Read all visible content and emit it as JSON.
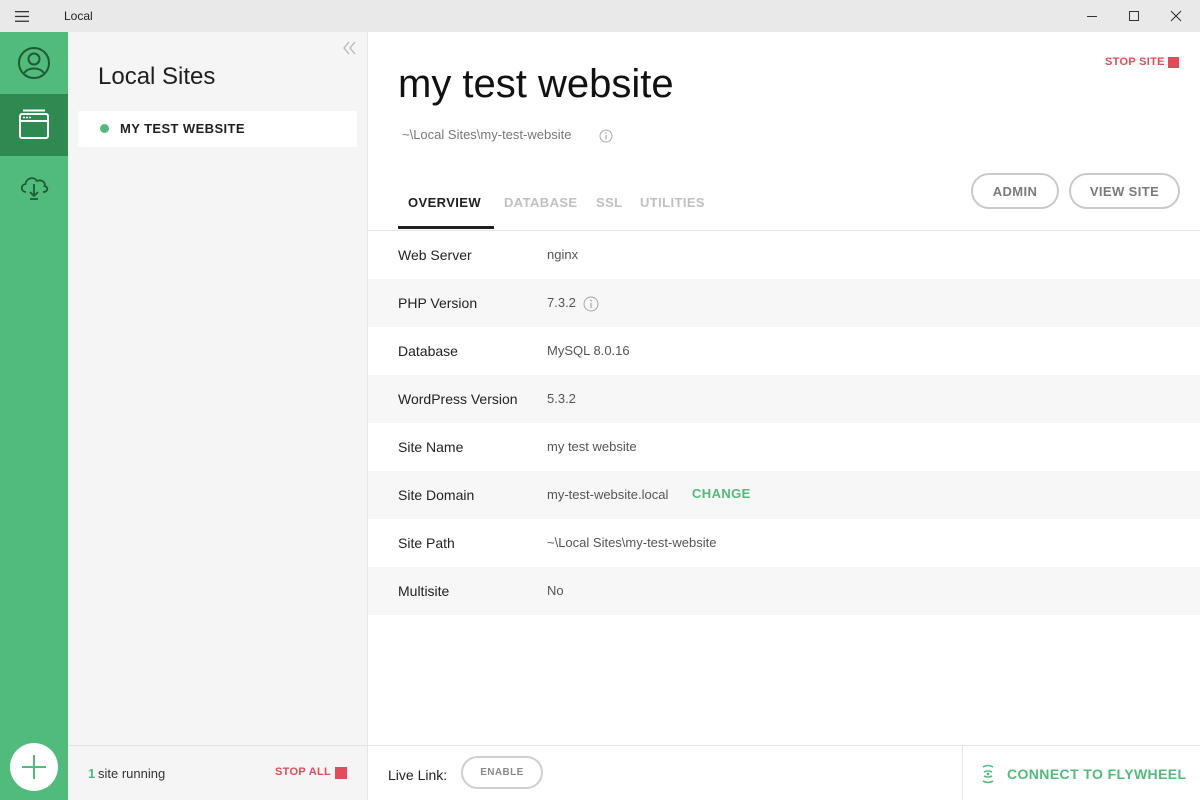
{
  "window": {
    "title": "Local"
  },
  "rail": {
    "icons": [
      "user-profile-icon",
      "local-sites-icon",
      "cloud-download-icon"
    ],
    "add_icon": "plus-icon"
  },
  "sites_panel": {
    "title": "Local Sites",
    "items": [
      {
        "name": "MY TEST WEBSITE",
        "status": "running"
      }
    ],
    "footer": {
      "running_count": "1",
      "running_text": "site running",
      "stop_all_label": "STOP ALL"
    }
  },
  "main": {
    "stop_site_label": "STOP SITE",
    "site_title": "my test website",
    "site_path": "~\\Local Sites\\my-test-website",
    "tabs": [
      {
        "label": "OVERVIEW",
        "active": true
      },
      {
        "label": "DATABASE",
        "active": false
      },
      {
        "label": "SSL",
        "active": false
      },
      {
        "label": "UTILITIES",
        "active": false
      }
    ],
    "buttons": {
      "admin": "ADMIN",
      "view_site": "VIEW SITE"
    },
    "rows": [
      {
        "label": "Web Server",
        "value": "nginx"
      },
      {
        "label": "PHP Version",
        "value": "7.3.2"
      },
      {
        "label": "Database",
        "value": "MySQL 8.0.16"
      },
      {
        "label": "WordPress Version",
        "value": "5.3.2"
      },
      {
        "label": "Site Name",
        "value": "my test website"
      },
      {
        "label": "Site Domain",
        "value": "my-test-website.local",
        "action": "CHANGE"
      },
      {
        "label": "Site Path",
        "value": "~\\Local Sites\\my-test-website"
      },
      {
        "label": "Multisite",
        "value": "No"
      }
    ],
    "footer": {
      "live_link_label": "Live Link:",
      "enable_label": "ENABLE",
      "flywheel_label": "CONNECT TO FLYWHEEL"
    }
  },
  "colors": {
    "brand_green": "#51bb7b",
    "rail_active": "#2f8a52",
    "stop_red": "#e14b5a"
  }
}
